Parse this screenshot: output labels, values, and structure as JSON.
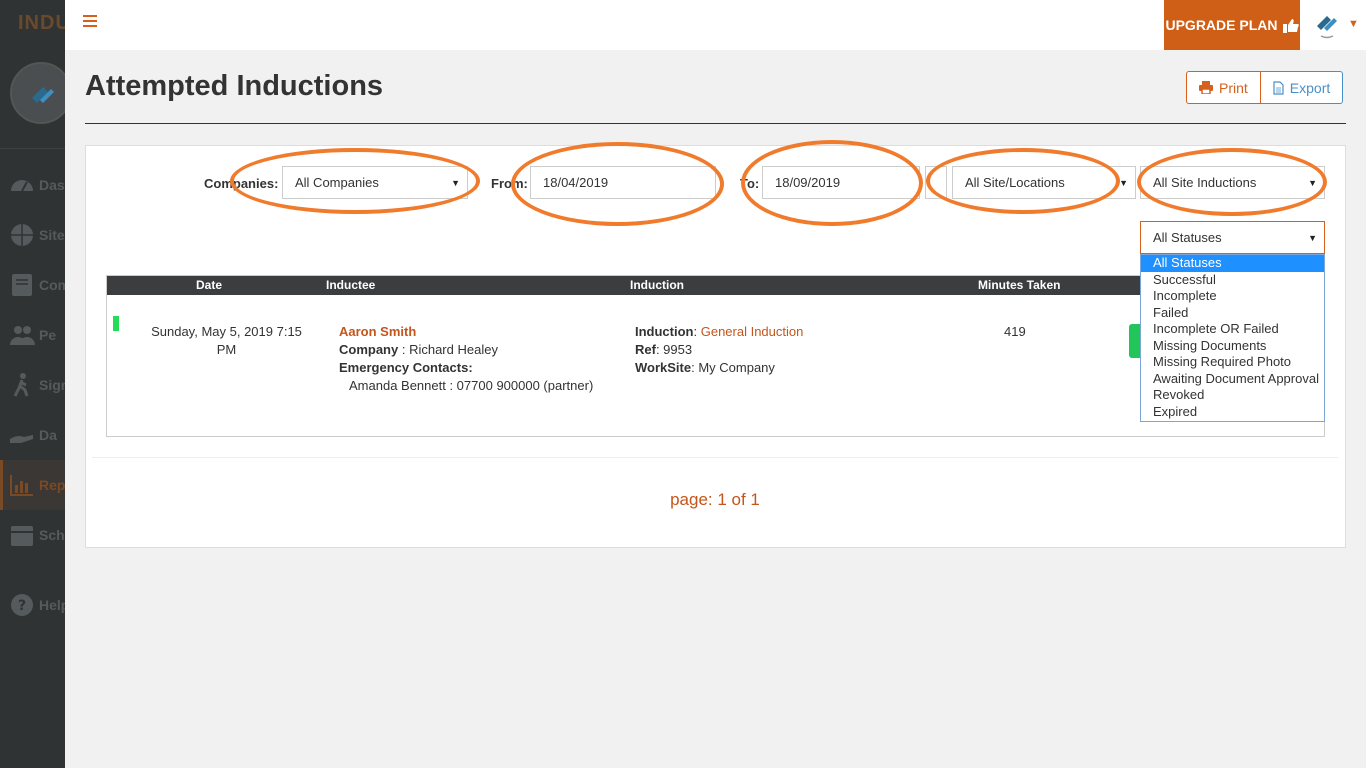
{
  "sidebar": {
    "brand": "INDUC",
    "items": [
      {
        "label": "Das",
        "icon": "dashboard-icon"
      },
      {
        "label": "Site",
        "icon": "globe-icon"
      },
      {
        "label": "Com",
        "icon": "book-icon"
      },
      {
        "label": "Pe",
        "icon": "people-icon"
      },
      {
        "label": "Sign",
        "icon": "walk-icon"
      },
      {
        "label": "Da",
        "icon": "hand-icon"
      },
      {
        "label": "Rep",
        "icon": "bar-chart-icon"
      },
      {
        "label": "Sche",
        "icon": "calendar-icon"
      },
      {
        "label": "Help",
        "icon": "help-icon"
      }
    ]
  },
  "topbar": {
    "upgrade_label": "UPGRADE PLAN"
  },
  "header": {
    "title": "Attempted Inductions",
    "print_label": "Print",
    "export_label": "Export"
  },
  "filters": {
    "companies_label": "Companies:",
    "companies_value": "All Companies",
    "from_label": "From:",
    "from_value": "18/04/2019",
    "to_label": "To:",
    "to_value": "18/09/2019",
    "site_value": "All Site/Locations",
    "inductions_value": "All Site Inductions",
    "status_value": "All Statuses",
    "status_options": [
      "All Statuses",
      "Successful",
      "Incomplete",
      "Failed",
      "Incomplete OR Failed",
      "Missing Documents",
      "Missing Required Photo",
      "Awaiting Document Approval",
      "Revoked",
      "Expired"
    ]
  },
  "table": {
    "columns": [
      "Date",
      "Inductee",
      "Induction",
      "Minutes Taken"
    ],
    "rows": [
      {
        "date_line1": "Sunday, May 5, 2019 7:15",
        "date_line2": "PM",
        "name": "Aaron Smith",
        "company_label": "Company",
        "company_value": " : Richard Healey",
        "emergency_label": "Emergency Contacts:",
        "emergency_value": "Amanda Bennett : 07700 900000 (partner)",
        "induction_label": "Induction",
        "induction_value": "General Induction",
        "ref_label": "Ref",
        "ref_value": ": 9953",
        "worksite_label": "WorkSite",
        "worksite_value": ": My Company",
        "minutes": "419"
      }
    ]
  },
  "pager": {
    "text": "page: 1 of 1"
  }
}
